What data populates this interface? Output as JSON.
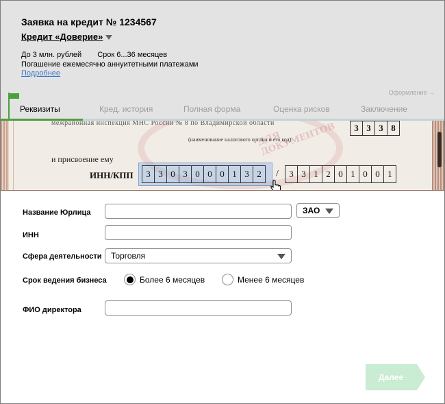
{
  "header": {
    "title": "Заявка на кредит № 1234567",
    "product": "Кредит «Доверие»",
    "limit": "До 3 млн. рублей",
    "term": "Срок 6...36 месяцев",
    "repayment": "Погашение ежемесячно аннуитетными платежами",
    "more_link": "Подробнее",
    "next_step_hint": "Оформление →"
  },
  "tabs": [
    {
      "label": "Реквизиты",
      "active": true
    },
    {
      "label": "Кред. история",
      "active": false
    },
    {
      "label": "Полная форма",
      "active": false
    },
    {
      "label": "Оценка рисков",
      "active": false
    },
    {
      "label": "Заключение",
      "active": false
    }
  ],
  "scan": {
    "top_text": "межрайонная инспекция МНС России № 8 по Владимирской области",
    "caption": "(наименование налогового органа и его код)",
    "assign_text": "и присвоение ему",
    "inn_label": "ИНН/КПП",
    "top_digits": [
      "3",
      "3",
      "3",
      "8"
    ],
    "inn_digits": [
      "3",
      "3",
      "0",
      "3",
      "0",
      "0",
      "0",
      "1",
      "3",
      "2"
    ],
    "separator": "/",
    "kpp_digits": [
      "3",
      "3",
      "1",
      "2",
      "0",
      "1",
      "0",
      "0",
      "1"
    ],
    "stamp_text": "ДЛЯ ДОКУМЕНТОВ"
  },
  "form": {
    "company_name_label": "Название Юрлица",
    "company_name_value": "",
    "legal_form_value": "ЗАО",
    "inn_label": "ИНН",
    "inn_value": "",
    "activity_label": "Сфера деятельности",
    "activity_value": "Торговля",
    "business_term_label": "Срок ведения бизнеса",
    "radio_more": "Более 6 месяцев",
    "radio_less": "Менее 6 месяцев",
    "radio_selected": "more",
    "director_label": "ФИО директора",
    "director_value": ""
  },
  "actions": {
    "next_label": "Далее"
  },
  "colors": {
    "accent_green": "#4aa03f",
    "next_button": "#c9ecd2",
    "header_bg": "#e3e3e3",
    "link": "#3a77c7"
  }
}
